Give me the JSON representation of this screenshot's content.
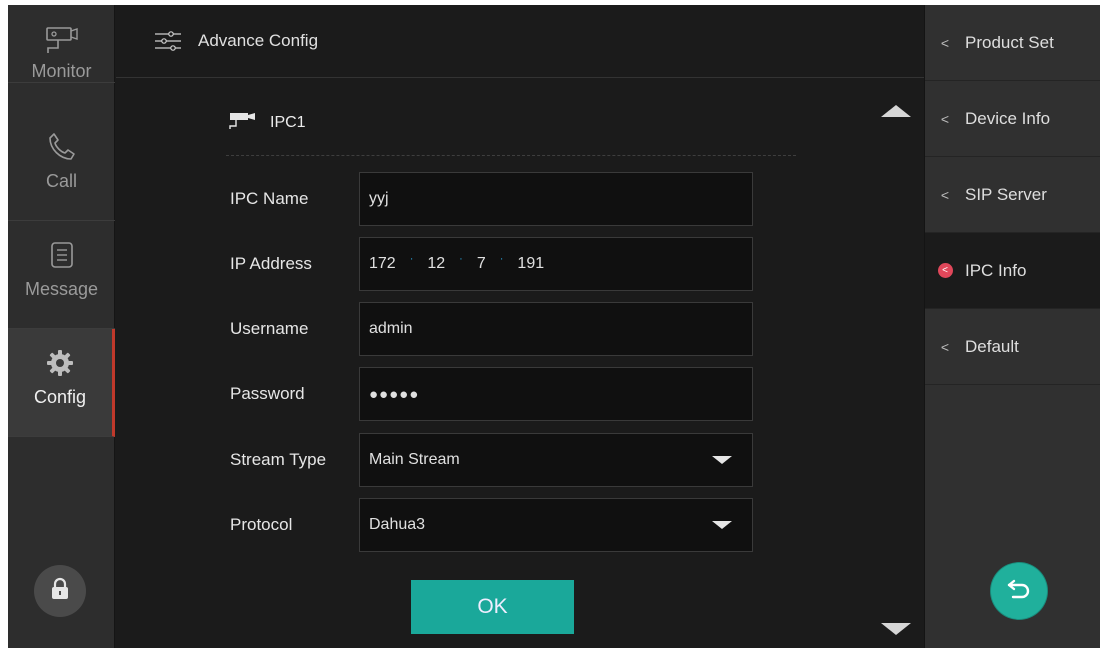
{
  "left_nav": {
    "items": [
      {
        "label": "Monitor",
        "icon": "camera-icon"
      },
      {
        "label": "Call",
        "icon": "phone-icon"
      },
      {
        "label": "Message",
        "icon": "message-list-icon"
      },
      {
        "label": "Config",
        "icon": "gear-icon",
        "active": true
      }
    ],
    "lock_icon": "lock-icon"
  },
  "header": {
    "title": "Advance Config",
    "icon": "sliders-icon"
  },
  "section": {
    "title": "IPC1",
    "icon": "ipc-camera-icon"
  },
  "form": {
    "ipc_name": {
      "label": "IPC Name",
      "value": "yyj"
    },
    "ip_address": {
      "label": "IP Address",
      "octets": [
        "172",
        "12",
        "7",
        "191"
      ]
    },
    "username": {
      "label": "Username",
      "value": "admin"
    },
    "password": {
      "label": "Password",
      "value": "●●●●●"
    },
    "stream_type": {
      "label": "Stream Type",
      "value": "Main Stream"
    },
    "protocol": {
      "label": "Protocol",
      "value": "Dahua3"
    }
  },
  "ok_label": "OK",
  "right_menu": {
    "items": [
      {
        "label": "Product Set"
      },
      {
        "label": "Device Info"
      },
      {
        "label": "SIP Server"
      },
      {
        "label": "IPC Info",
        "active": true
      },
      {
        "label": "Default"
      }
    ],
    "back_icon": "back-arrow-icon"
  },
  "colors": {
    "accent": "#1aa89a",
    "active_marker": "#c0392b",
    "active_dot": "#e0475a",
    "ip_separator": "#2a9fd6"
  }
}
